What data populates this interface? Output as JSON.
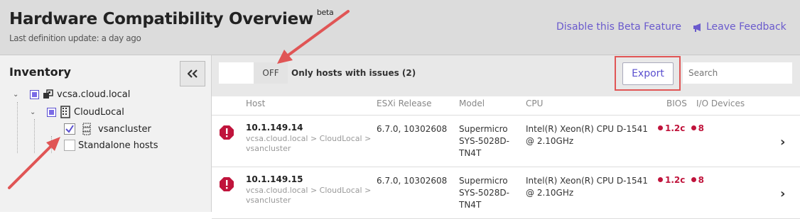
{
  "header": {
    "title": "Hardware Compatibility Overview",
    "title_sup": "beta",
    "subtitle": "Last definition update: a day ago",
    "disable_beta": "Disable this Beta Feature",
    "leave_feedback": "Leave Feedback"
  },
  "sidebar": {
    "title": "Inventory",
    "tree": [
      {
        "label": "vcsa.cloud.local",
        "checkbox": "partial",
        "icon": "vcenter-icon"
      },
      {
        "label": "CloudLocal",
        "checkbox": "partial",
        "icon": "datacenter-icon"
      },
      {
        "label": "vsancluster",
        "checkbox": "checked",
        "icon": "cluster-icon"
      },
      {
        "label": "Standalone hosts",
        "checkbox": "empty"
      }
    ]
  },
  "toolbar": {
    "toggle_state": "OFF",
    "filter_label": "Only hosts with issues (2)",
    "export_label": "Export",
    "search_placeholder": "Search"
  },
  "table": {
    "columns": [
      "Host",
      "ESXi Release",
      "Model",
      "CPU",
      "BIOS",
      "I/O Devices"
    ],
    "rows": [
      {
        "host": "10.1.149.14",
        "path": "vcsa.cloud.local > CloudLocal > vsancluster",
        "release": "6.7.0, 10302608",
        "model": "Supermicro SYS-5028D-TN4T",
        "cpu": "Intel(R) Xeon(R) CPU D-1541 @ 2.10GHz",
        "bios": "1.2c",
        "io": "8"
      },
      {
        "host": "10.1.149.15",
        "path": "vcsa.cloud.local > CloudLocal > vsancluster",
        "release": "6.7.0, 10302608",
        "model": "Supermicro SYS-5028D-TN4T",
        "cpu": "Intel(R) Xeon(R) CPU D-1541 @ 2.10GHz",
        "bios": "1.2c",
        "io": "8"
      }
    ]
  },
  "colors": {
    "accent": "#6a5acd",
    "error": "#c0143c",
    "annotation": "#e05555"
  }
}
